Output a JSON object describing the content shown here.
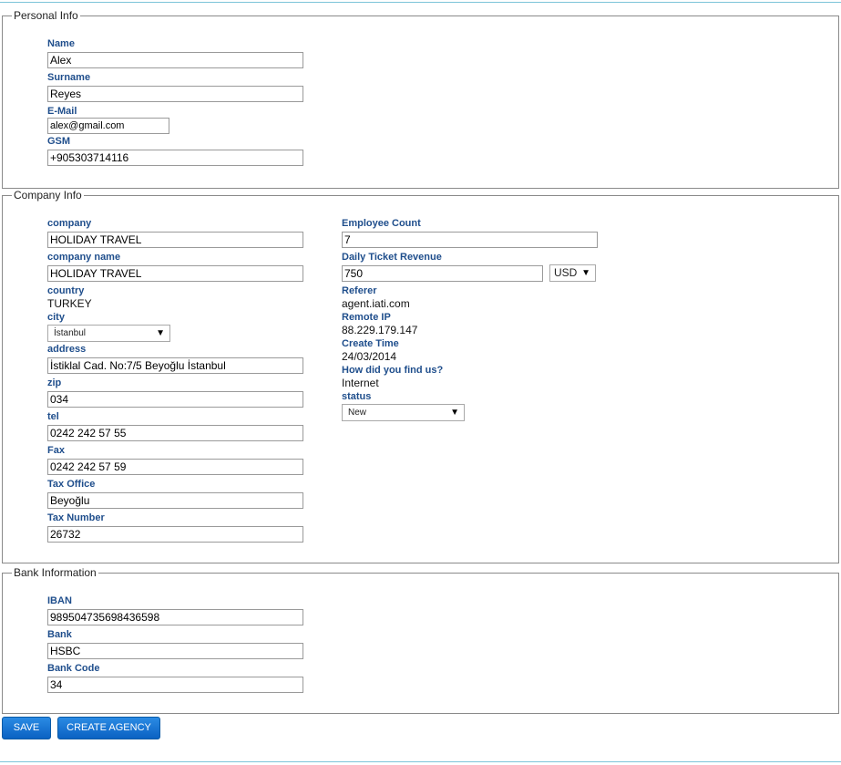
{
  "personal": {
    "legend": "Personal Info",
    "name_label": "Name",
    "name_value": "Alex",
    "surname_label": "Surname",
    "surname_value": "Reyes",
    "email_label": "E-Mail",
    "email_value": "alex@gmail.com",
    "gsm_label": "GSM",
    "gsm_value": "+905303714116"
  },
  "company": {
    "legend": "Company Info",
    "company_label": "company",
    "company_value": "HOLIDAY TRAVEL",
    "company_name_label": "company name",
    "company_name_value": "HOLIDAY TRAVEL",
    "country_label": "country",
    "country_value": "TURKEY",
    "city_label": "city",
    "city_value": "İstanbul",
    "address_label": "address",
    "address_value": "İstiklal Cad. No:7/5 Beyoğlu İstanbul",
    "zip_label": "zip",
    "zip_value": "034",
    "tel_label": "tel",
    "tel_value": "0242 242 57 55",
    "fax_label": "Fax",
    "fax_value": "0242 242 57 59",
    "tax_office_label": "Tax Office",
    "tax_office_value": "Beyoğlu",
    "tax_number_label": "Tax Number",
    "tax_number_value": "26732",
    "employee_count_label": "Employee Count",
    "employee_count_value": "7",
    "daily_ticket_label": "Daily Ticket Revenue",
    "daily_ticket_value": "750",
    "currency_value": "USD",
    "referer_label": "Referer",
    "referer_value": "agent.iati.com",
    "remote_ip_label": "Remote IP",
    "remote_ip_value": "88.229.179.147",
    "create_time_label": "Create Time",
    "create_time_value": "24/03/2014",
    "how_found_label": "How did you find us?",
    "how_found_value": "Internet",
    "status_label": "status",
    "status_value": "New"
  },
  "bank": {
    "legend": "Bank Information",
    "iban_label": "IBAN",
    "iban_value": "989504735698436598",
    "bank_label": "Bank",
    "bank_value": "HSBC",
    "bank_code_label": "Bank Code",
    "bank_code_value": "34"
  },
  "actions": {
    "save_label": "SAVE",
    "create_agency_label": "CREATE AGENCY"
  },
  "colors": {
    "label": "#1f4e8c",
    "button": "#1a73d6",
    "rule": "#7cc4d8"
  }
}
